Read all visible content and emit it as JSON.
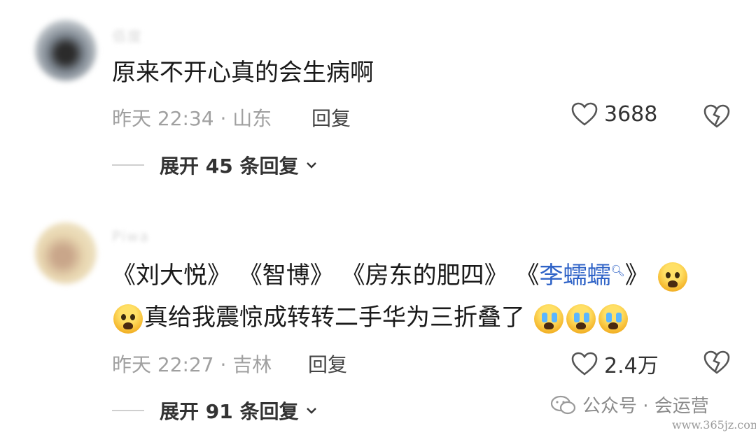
{
  "comments": [
    {
      "username": "佰度",
      "text": "原来不开心真的会生病啊",
      "meta": "昨天 22:34 · 山东",
      "reply_label": "回复",
      "likes": "3688",
      "expand_label": "展开 45 条回复"
    },
    {
      "username": "Piwa",
      "line1_parts": [
        "《刘大悦》",
        "《智博》",
        "《房东的肥四》",
        "《",
        "李蠕蠕",
        "》"
      ],
      "search_icon": "search-icon",
      "line2": "真给我震惊成转转二手华为三折叠了",
      "emojis": [
        "scream-emoji",
        "cry-emoji"
      ],
      "meta": "昨天 22:27 · 吉林",
      "reply_label": "回复",
      "likes": "2.4万",
      "expand_label": "展开 91 条回复"
    }
  ],
  "watermark": {
    "text": "公众号 · 会运营",
    "site": "www.365jz.com"
  },
  "colors": {
    "link": "#2f63c7",
    "meta": "#a0a0a0",
    "text": "#1a1a1a"
  }
}
